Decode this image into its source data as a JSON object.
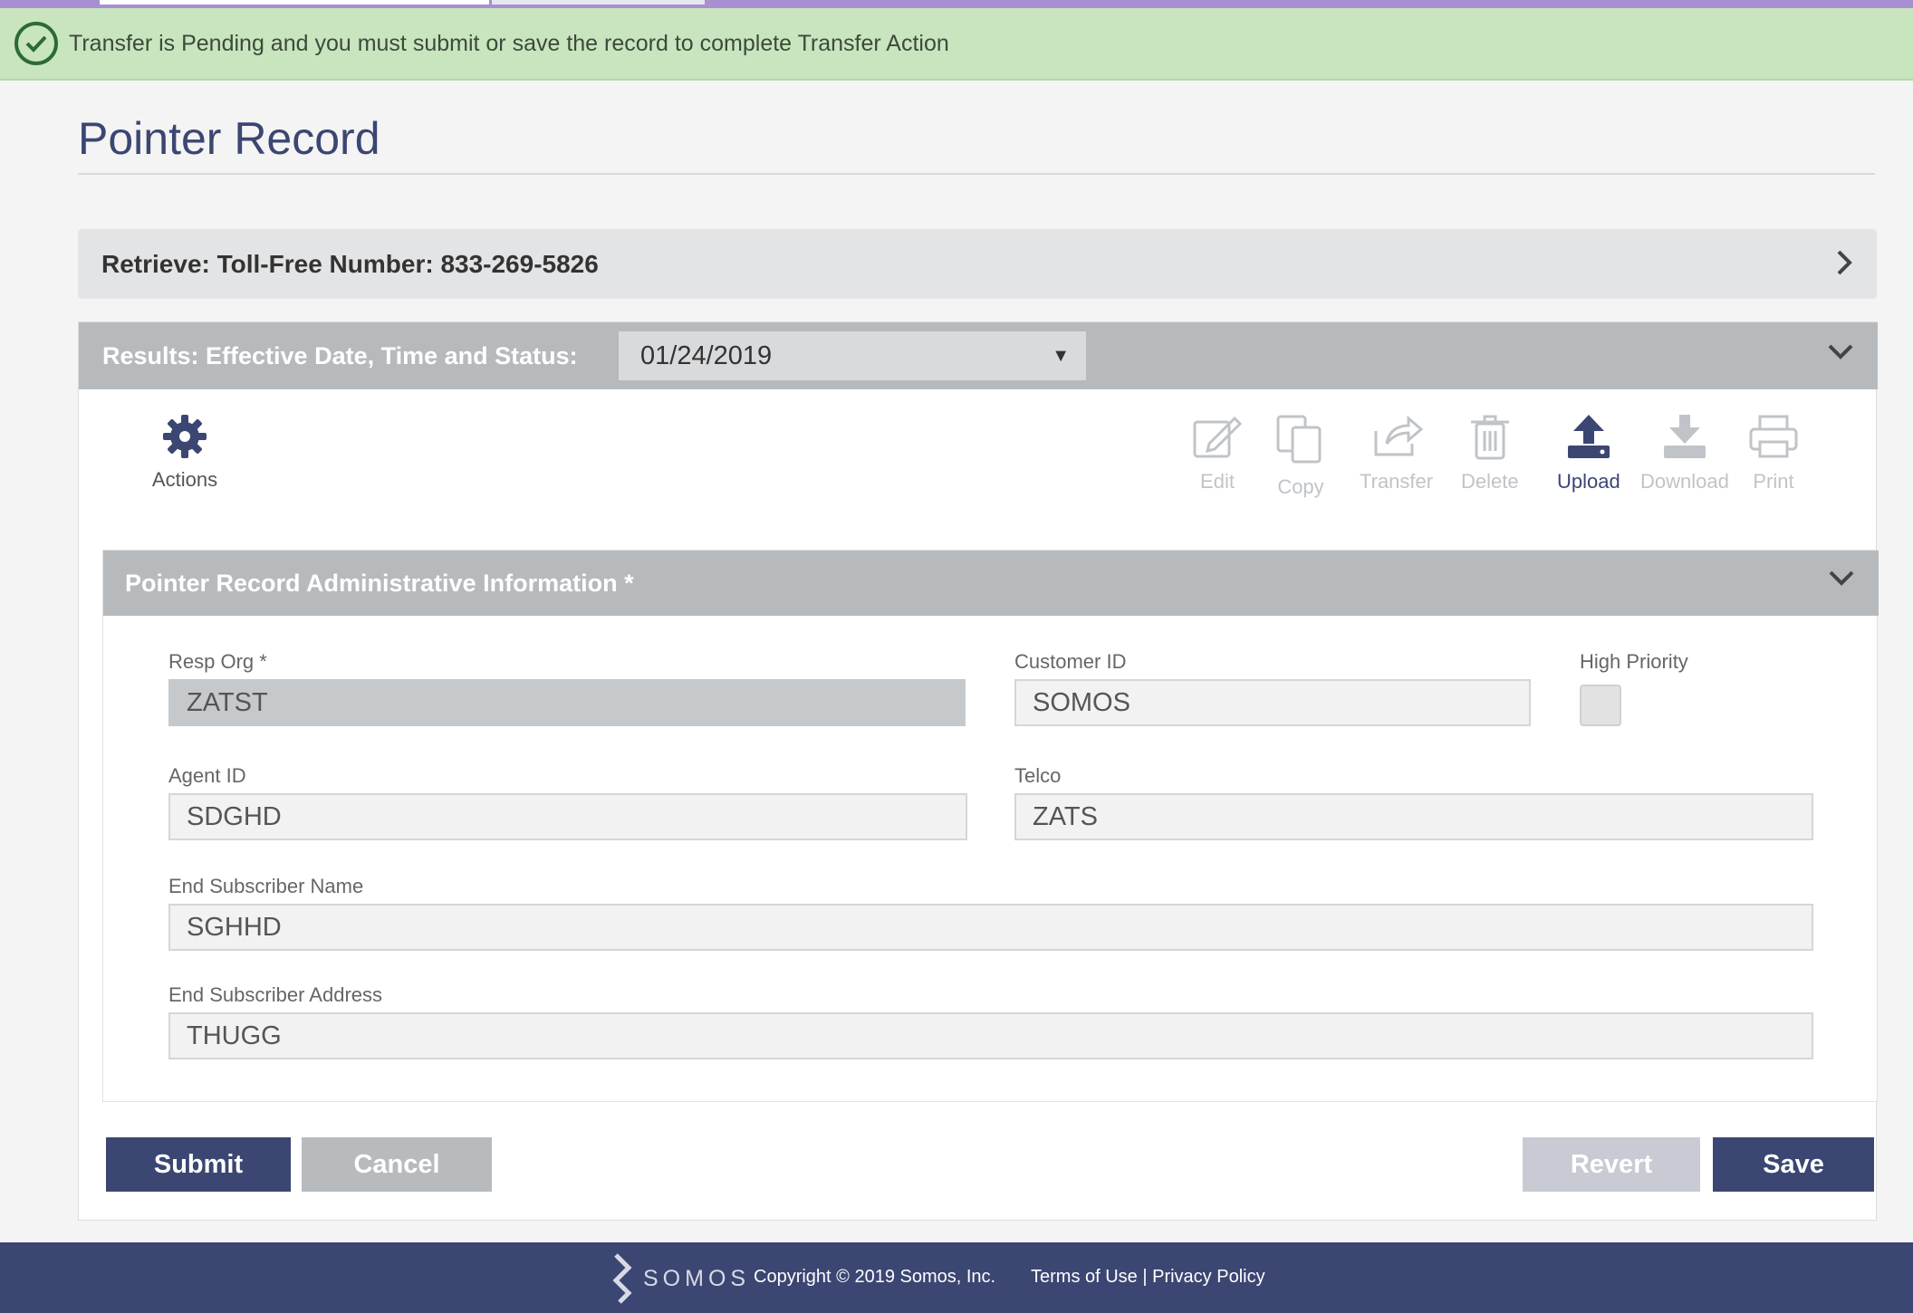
{
  "alert": {
    "message": "Transfer is Pending and you must submit or save the record to complete Transfer Action",
    "icon": "check-circle-icon"
  },
  "page": {
    "title": "Pointer Record"
  },
  "retrieve": {
    "label": "Retrieve: Toll-Free Number: 833-269-5826"
  },
  "results": {
    "label": "Results: Effective Date, Time and Status:",
    "selected_date": "01/24/2019"
  },
  "toolbar": {
    "actions_label": "Actions",
    "edit": "Edit",
    "copy": "Copy",
    "transfer": "Transfer",
    "delete": "Delete",
    "upload": "Upload",
    "download": "Download",
    "print": "Print"
  },
  "admin": {
    "title": "Pointer Record Administrative Information *",
    "resp_org": {
      "label": "Resp Org *",
      "value": "ZATST"
    },
    "customer_id": {
      "label": "Customer ID",
      "value": "SOMOS"
    },
    "high_priority": {
      "label": "High Priority",
      "checked": false
    },
    "agent_id": {
      "label": "Agent ID",
      "value": "SDGHD"
    },
    "telco": {
      "label": "Telco",
      "value": "ZATS"
    },
    "end_subscriber_name": {
      "label": "End Subscriber Name",
      "value": "SGHHD"
    },
    "end_subscriber_address": {
      "label": "End Subscriber Address",
      "value": "THUGG"
    }
  },
  "buttons": {
    "submit": "Submit",
    "cancel": "Cancel",
    "revert": "Revert",
    "save": "Save"
  },
  "footer": {
    "brand": "SOMOS",
    "copyright": "Copyright © 2019 Somos, Inc.",
    "links": "Terms of Use | Privacy Policy"
  },
  "colors": {
    "primary": "#3b4672",
    "alert_bg": "#c9e5bf",
    "header_gray": "#b7babd"
  }
}
